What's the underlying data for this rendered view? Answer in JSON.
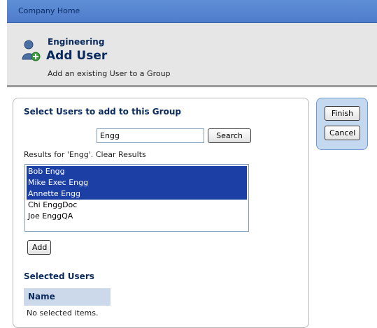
{
  "topbar": {
    "breadcrumb": "Company Home"
  },
  "header": {
    "context": "Engineering",
    "title": "Add User",
    "subtitle": "Add an existing User to a Group",
    "icon": "user-add-icon"
  },
  "panel": {
    "heading": "Select Users to add to this Group",
    "search": {
      "value": "Engg",
      "button": "Search"
    },
    "results_label": "Results for 'Engg'. Clear Results",
    "results": [
      {
        "label": "Bob Engg",
        "selected": true
      },
      {
        "label": "Mike Exec Engg",
        "selected": true
      },
      {
        "label": "Annette Engg",
        "selected": true
      },
      {
        "label": "Chi EnggDoc",
        "selected": false
      },
      {
        "label": "Joe EnggQA",
        "selected": false
      }
    ],
    "add_button": "Add",
    "selected_heading": "Selected Users",
    "table": {
      "column": "Name",
      "empty": "No selected items."
    }
  },
  "actions": {
    "finish": "Finish",
    "cancel": "Cancel"
  },
  "colors": {
    "topbar": "#4f7ccb",
    "selection": "#1c3fa6",
    "action_panel": "#c4d8f0"
  }
}
